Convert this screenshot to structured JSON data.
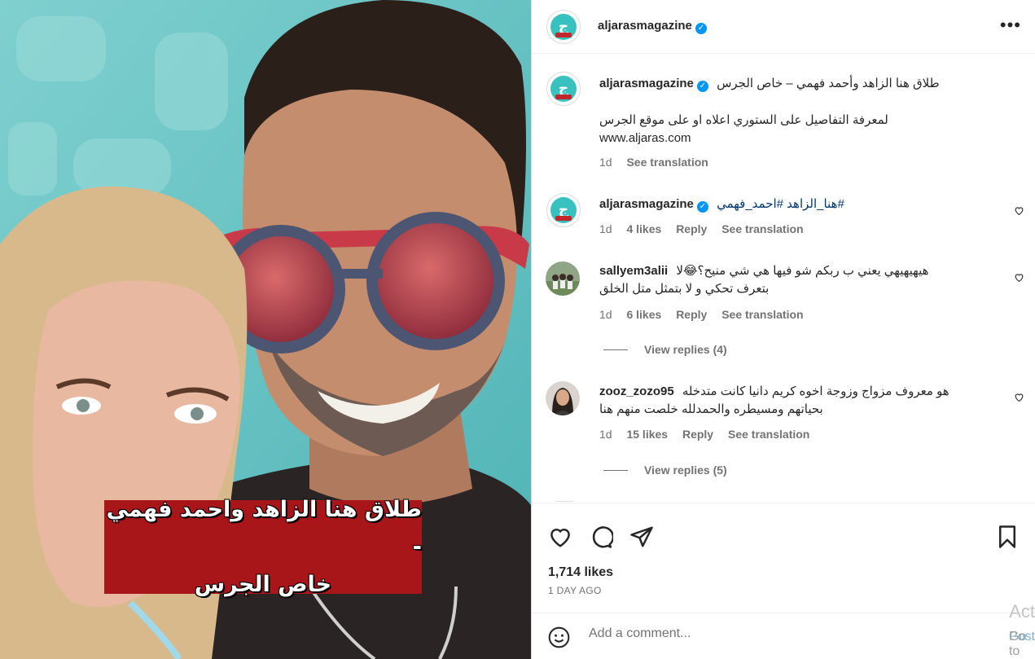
{
  "post": {
    "overlay_caption_line1": "طلاق هنا الزاهد واحمد فهمي -",
    "overlay_caption_line2": "خاص الجرس"
  },
  "header": {
    "username": "aljarasmagazine",
    "verified_icon": "verified-badge-icon",
    "more_icon": "more-options-icon"
  },
  "caption": {
    "username": "aljarasmagazine",
    "title": "طلاق هنا الزاهد وأحمد فهمي – خاص الجرس",
    "body": "لمعرفة التفاصيل على الستوري اعلاه او على موقع الجرس",
    "link": "www.aljaras.com",
    "age": "1d",
    "see_translation": "See translation"
  },
  "comments": [
    {
      "username": "aljarasmagazine",
      "text": "#هنا_الزاهد #احمد_فهمي",
      "age": "1d",
      "likes": "4 likes",
      "reply": "Reply",
      "see_translation": "See translation"
    },
    {
      "username": "sallyem3alii",
      "text": "هيهيهيهي يعني ب ربكم شو فيها هي شي منيح؟😂لا",
      "text2": "بتعرف تحكي و لا بتمثل متل الخلق",
      "age": "1d",
      "likes": "6 likes",
      "reply": "Reply",
      "see_translation": "See translation",
      "view_replies": "View replies (4)"
    },
    {
      "username": "zooz_zozo95",
      "text": "هو معروف مزواج وزوجة اخوه كريم دانيا كانت متدخله",
      "text2": "بحياتهم ومسيطره والحمدلله خلصت منهم هنا",
      "age": "1d",
      "likes": "15 likes",
      "reply": "Reply",
      "see_translation": "See translation",
      "view_replies": "View replies (5)"
    }
  ],
  "actions": {
    "likes": "1,714 likes",
    "time": "1 DAY AGO"
  },
  "add_comment": {
    "placeholder": "Add a comment...",
    "post_label": "Post"
  },
  "system_overlay": {
    "line1": "Act",
    "line2": "Go to"
  },
  "colors": {
    "verified": "#0095f6",
    "brand_teal": "#38c1bf",
    "caption_red": "#a8161a",
    "muted": "#737373"
  }
}
